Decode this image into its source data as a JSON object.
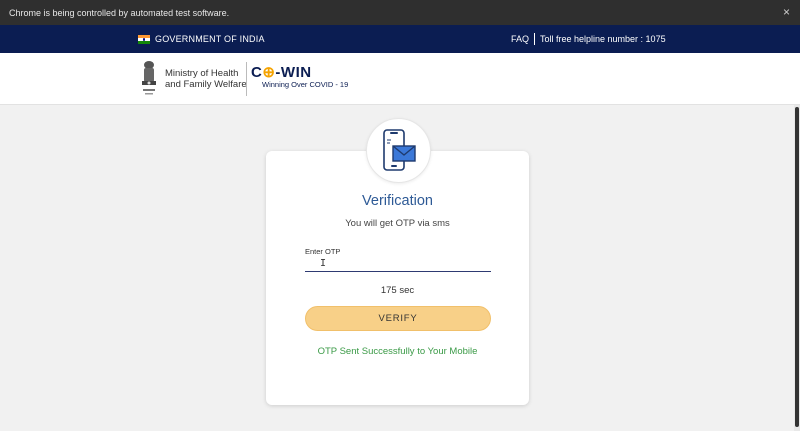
{
  "browser": {
    "banner_text": "Chrome is being controlled by automated test software.",
    "close_glyph": "×"
  },
  "top_bar": {
    "government": "GOVERNMENT OF INDIA",
    "faq": "FAQ",
    "helpline": "Toll free helpline number : 1075",
    "background_color": "#0b1d52"
  },
  "header": {
    "ministry_line1": "Ministry of Health",
    "ministry_line2": "and Family Welfare",
    "logo_co": "C",
    "logo_plus": "⊕",
    "logo_win": "-WIN",
    "logo_tagline": "Winning Over COVID - 19"
  },
  "verification": {
    "icon": "phone-message-icon",
    "title": "Verification",
    "subtitle": "You will get OTP via sms",
    "otp_label": "Enter OTP",
    "otp_value": "",
    "timer": "175 sec",
    "verify_label": "VERIFY",
    "success_message": "OTP Sent Successfully to Your Mobile",
    "accent_color": "#2e5a96",
    "button_color": "#f8d088",
    "success_color": "#3a9a46"
  }
}
